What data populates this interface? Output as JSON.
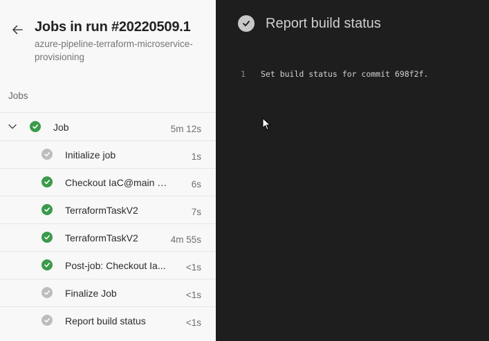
{
  "header": {
    "title": "Jobs in run #20220509.1",
    "pipeline": "azure-pipeline-terraform-microservice-provisioning"
  },
  "section_label": "Jobs",
  "job": {
    "label": "Job",
    "duration": "5m 12s",
    "status": "success",
    "expanded": true
  },
  "steps": [
    {
      "label": "Initialize job",
      "duration": "1s",
      "status": "skipped"
    },
    {
      "label": "Checkout IaC@main to s",
      "duration": "6s",
      "status": "success"
    },
    {
      "label": "TerraformTaskV2",
      "duration": "7s",
      "status": "success"
    },
    {
      "label": "TerraformTaskV2",
      "duration": "4m 55s",
      "status": "success"
    },
    {
      "label": "Post-job: Checkout Ia...",
      "duration": "<1s",
      "status": "success"
    },
    {
      "label": "Finalize Job",
      "duration": "<1s",
      "status": "skipped"
    },
    {
      "label": "Report build status",
      "duration": "<1s",
      "status": "skipped"
    }
  ],
  "log": {
    "title": "Report build status",
    "lines": [
      {
        "number": "1",
        "text": "Set build status for commit 698f2f."
      }
    ]
  },
  "colors": {
    "success": "#3b9a4b",
    "skipped": "#bdbdbd",
    "log_bg": "#1e1e1e"
  }
}
